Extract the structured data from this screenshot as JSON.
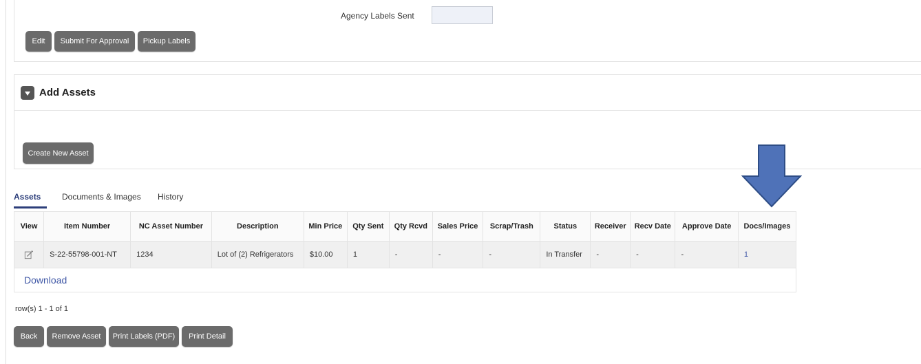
{
  "top": {
    "agency_labels_sent_label": "Agency Labels Sent",
    "agency_labels_sent_value": "",
    "buttons": {
      "edit": "Edit",
      "submit": "Submit For Approval",
      "pickup": "Pickup Labels"
    }
  },
  "add_assets": {
    "title": "Add Assets",
    "create_button": "Create New Asset"
  },
  "tabs": [
    "Assets",
    "Documents & Images",
    "History"
  ],
  "table": {
    "headers": [
      "View",
      "Item Number",
      "NC Asset Number",
      "Description",
      "Min Price",
      "Qty Sent",
      "Qty Rcvd",
      "Sales Price",
      "Scrap/Trash",
      "Status",
      "Receiver",
      "Recv Date",
      "Approve Date",
      "Docs/Images"
    ],
    "rows": [
      {
        "view_icon": "edit-icon",
        "item_number": "S-22-55798-001-NT",
        "nc_asset_number": "1234",
        "description": "Lot of (2) Refrigerators",
        "min_price": "$10.00",
        "qty_sent": "1",
        "qty_rcvd": "-",
        "sales_price": "-",
        "scrap_trash": "-",
        "status": "In Transfer",
        "receiver": "-",
        "recv_date": "-",
        "approve_date": "-",
        "docs_images": "1"
      }
    ],
    "download": "Download",
    "row_count": "row(s) 1 - 1 of 1"
  },
  "bottom_buttons": {
    "back": "Back",
    "remove": "Remove Asset",
    "print_labels": "Print Labels (PDF)",
    "print_detail": "Print Detail"
  },
  "colors": {
    "button": "#6b6b6b",
    "accent": "#2c3e7a",
    "link": "#3f57a6",
    "arrow": "#4f72b8"
  }
}
